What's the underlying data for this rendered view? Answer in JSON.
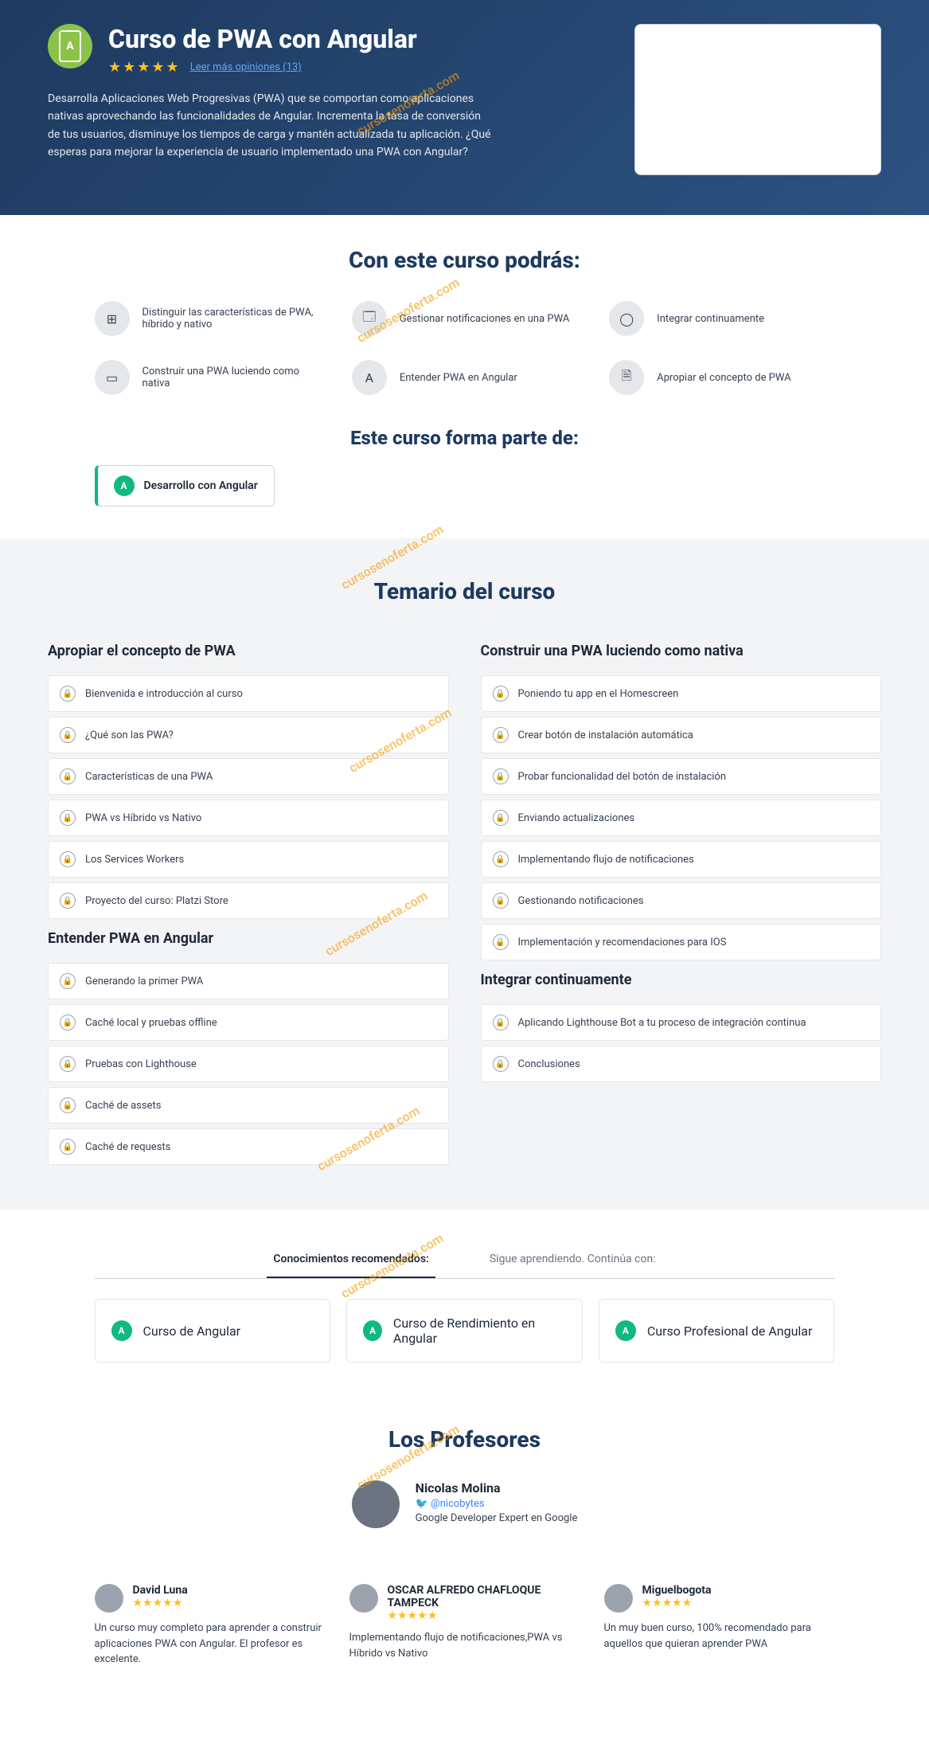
{
  "hero": {
    "title": "Curso de PWA con Angular",
    "reviews_link": "Leer más opiniones (13)",
    "description": "Desarrolla Aplicaciones Web Progresivas (PWA) que se comportan como aplicaciones nativas aprovechando las funcionalidades de Angular. Incrementa la tasa de conversión de tus usuarios, disminuye los tiempos de carga y mantén actualizada tu aplicación. ¿Qué esperas para mejorar la experiencia de usuario implementado una PWA con Angular?"
  },
  "skills_title": "Con este curso podrás:",
  "skills": [
    {
      "text": "Distinguir las características de PWA, híbrido y nativo",
      "icon": "⊞"
    },
    {
      "text": "Gestionar notificaciones en una PWA",
      "icon": "🗔"
    },
    {
      "text": "Integrar continuamente",
      "icon": "◯"
    },
    {
      "text": "Construir una PWA luciendo como nativa",
      "icon": "▭"
    },
    {
      "text": "Entender PWA en Angular",
      "icon": "A"
    },
    {
      "text": "Apropiar el concepto de PWA",
      "icon": "🗎"
    }
  ],
  "part_of_title": "Este curso forma parte de:",
  "track": {
    "label": "Desarrollo con Angular"
  },
  "temario_title": "Temario del curso",
  "modules_left": [
    {
      "title": "Apropiar el concepto de PWA",
      "lessons": [
        "Bienvenida e introducción al curso",
        "¿Qué son las PWA?",
        "Características de una PWA",
        "PWA vs Híbrido vs Nativo",
        "Los Services Workers",
        "Proyecto del curso: Platzi Store"
      ]
    },
    {
      "title": "Entender PWA en Angular",
      "lessons": [
        "Generando la primer PWA",
        "Caché local y pruebas offline",
        "Pruebas con Lighthouse",
        "Caché de assets",
        "Caché de requests"
      ]
    }
  ],
  "modules_right": [
    {
      "title": "Construir una PWA luciendo como nativa",
      "lessons": [
        "Poniendo tu app en el Homescreen",
        "Crear botón de instalación automática",
        "Probar funcionalidad del botón de instalación",
        "Enviando actualizaciones",
        "Implementando flujo de notificaciones",
        "Gestionando notificaciones",
        "Implementación y recomendaciones para IOS"
      ]
    },
    {
      "title": "Integrar continuamente",
      "lessons": [
        "Aplicando Lighthouse Bot a tu proceso de integración continua",
        "Conclusiones"
      ]
    }
  ],
  "tabs": {
    "active": "Conocimientos recomendados:",
    "other": "Sigue aprendiendo. Continúa con:"
  },
  "related": [
    "Curso de Angular",
    "Curso de Rendimiento en Angular",
    "Curso Profesional de Angular"
  ],
  "prof_title": "Los Profesores",
  "prof": {
    "name": "Nicolas Molina",
    "handle": "@nicobytes",
    "role": "Google Developer Expert en Google"
  },
  "reviews": [
    {
      "name": "David Luna",
      "text": "Un curso muy completo para aprender a construir aplicaciones PWA con Angular. El profesor es excelente."
    },
    {
      "name": "OSCAR ALFREDO CHAFLOQUE TAMPECK",
      "text": "Implementando flujo de notificaciones,PWA vs Híbrido vs Nativo"
    },
    {
      "name": "Miguelbogota",
      "text": "Un muy buen curso, 100% recomendado para aquellos que quieran aprender PWA"
    }
  ],
  "watermark": "cursosenoferta.com"
}
